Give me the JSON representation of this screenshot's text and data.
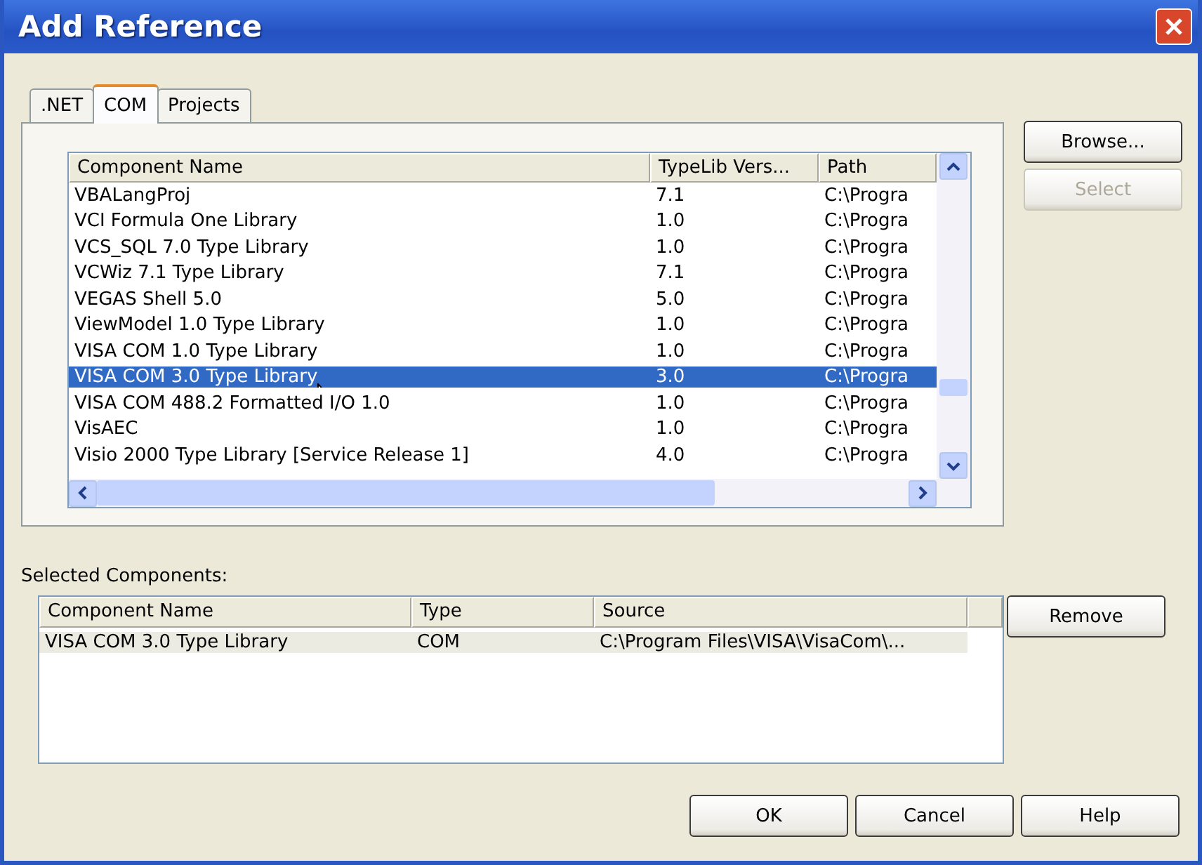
{
  "window": {
    "title": "Add Reference"
  },
  "tabs": [
    {
      "label": ".NET",
      "selected": false
    },
    {
      "label": "COM",
      "selected": true
    },
    {
      "label": "Projects",
      "selected": false
    }
  ],
  "components": {
    "columns": [
      "Component Name",
      "TypeLib Vers...",
      "Path"
    ],
    "rows": [
      {
        "name": "VBALangProj",
        "version": "7.1",
        "path": "C:\\Progra",
        "selected": false
      },
      {
        "name": "VCI Formula One Library",
        "version": "1.0",
        "path": "C:\\Progra",
        "selected": false
      },
      {
        "name": "VCS_SQL 7.0 Type Library",
        "version": "1.0",
        "path": "C:\\Progra",
        "selected": false
      },
      {
        "name": "VCWiz 7.1 Type Library",
        "version": "7.1",
        "path": "C:\\Progra",
        "selected": false
      },
      {
        "name": "VEGAS Shell 5.0",
        "version": "5.0",
        "path": "C:\\Progra",
        "selected": false
      },
      {
        "name": "ViewModel 1.0 Type Library",
        "version": "1.0",
        "path": "C:\\Progra",
        "selected": false
      },
      {
        "name": "VISA COM 1.0 Type Library",
        "version": "1.0",
        "path": "C:\\Progra",
        "selected": false
      },
      {
        "name": "VISA COM 3.0 Type Library",
        "version": "3.0",
        "path": "C:\\Progra",
        "selected": true
      },
      {
        "name": "VISA COM 488.2 Formatted I/O 1.0",
        "version": "1.0",
        "path": "C:\\Progra",
        "selected": false
      },
      {
        "name": "VisAEC",
        "version": "1.0",
        "path": "C:\\Progra",
        "selected": false
      },
      {
        "name": "Visio 2000 Type Library [Service Release 1]",
        "version": "4.0",
        "path": "C:\\Progra",
        "selected": false
      }
    ]
  },
  "side_buttons": [
    {
      "label": "Browse...",
      "disabled": false
    },
    {
      "label": "Select",
      "disabled": true
    }
  ],
  "selected_components": {
    "label": "Selected Components:",
    "columns": [
      "Component Name",
      "Type",
      "Source"
    ],
    "rows": [
      {
        "name": "VISA COM 3.0 Type Library",
        "type": "COM",
        "source": "C:\\Program Files\\VISA\\VisaCom\\...",
        "selected": true
      }
    ]
  },
  "remove_button": "Remove",
  "buttons": [
    "OK",
    "Cancel",
    "Help"
  ]
}
